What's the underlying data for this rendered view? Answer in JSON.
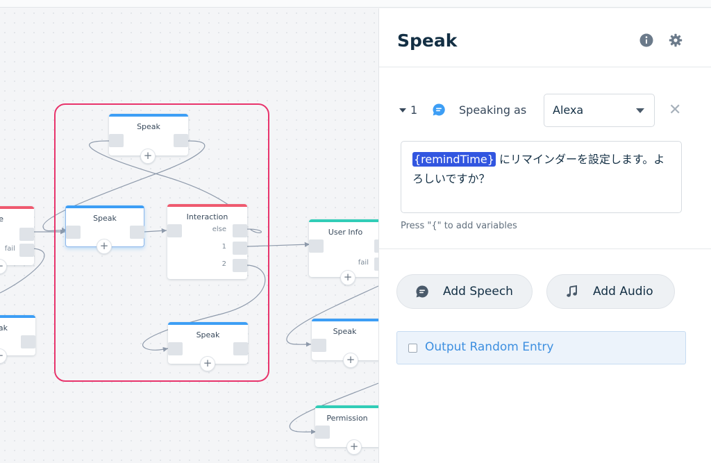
{
  "canvas": {
    "blocks": [
      {
        "id": "edge-top",
        "title": "e",
        "ports": [
          "fail"
        ]
      },
      {
        "id": "edge-bottom",
        "title": "ak"
      },
      {
        "id": "speak-top",
        "title": "Speak"
      },
      {
        "id": "speak-mid",
        "title": "Speak"
      },
      {
        "id": "interaction",
        "title": "Interaction",
        "ports": [
          "else",
          "1",
          "2"
        ]
      },
      {
        "id": "speak-bottom",
        "title": "Speak"
      },
      {
        "id": "user-info",
        "title": "User Info",
        "ports": [
          "fail"
        ]
      },
      {
        "id": "speak-right",
        "title": "Speak"
      },
      {
        "id": "permission",
        "title": "Permission"
      }
    ],
    "plus_symbol": "+",
    "group_color": "#e8336b"
  },
  "panel": {
    "title": "Speak",
    "info_icon": "info-icon",
    "settings_icon": "gear-icon",
    "step": {
      "index": "1",
      "speaking_as_label": "Speaking as",
      "voice_value": "Alexa",
      "close_symbol": "✕",
      "text_variable": "{remindTime}",
      "text_rest": " にリマインダーを設定します。よろしいですか？",
      "hint": "Press \"{\" to add variables"
    },
    "add_speech_label": "Add Speech",
    "add_audio_label": "Add Audio",
    "output_random_label": "Output Random Entry"
  },
  "colors": {
    "speak_accent": "#3d9ef5",
    "interaction_accent": "#ef5a6f",
    "teal_accent": "#31cdb7",
    "variable_chip": "#3256e0",
    "link_blue": "#3d8fe0"
  }
}
